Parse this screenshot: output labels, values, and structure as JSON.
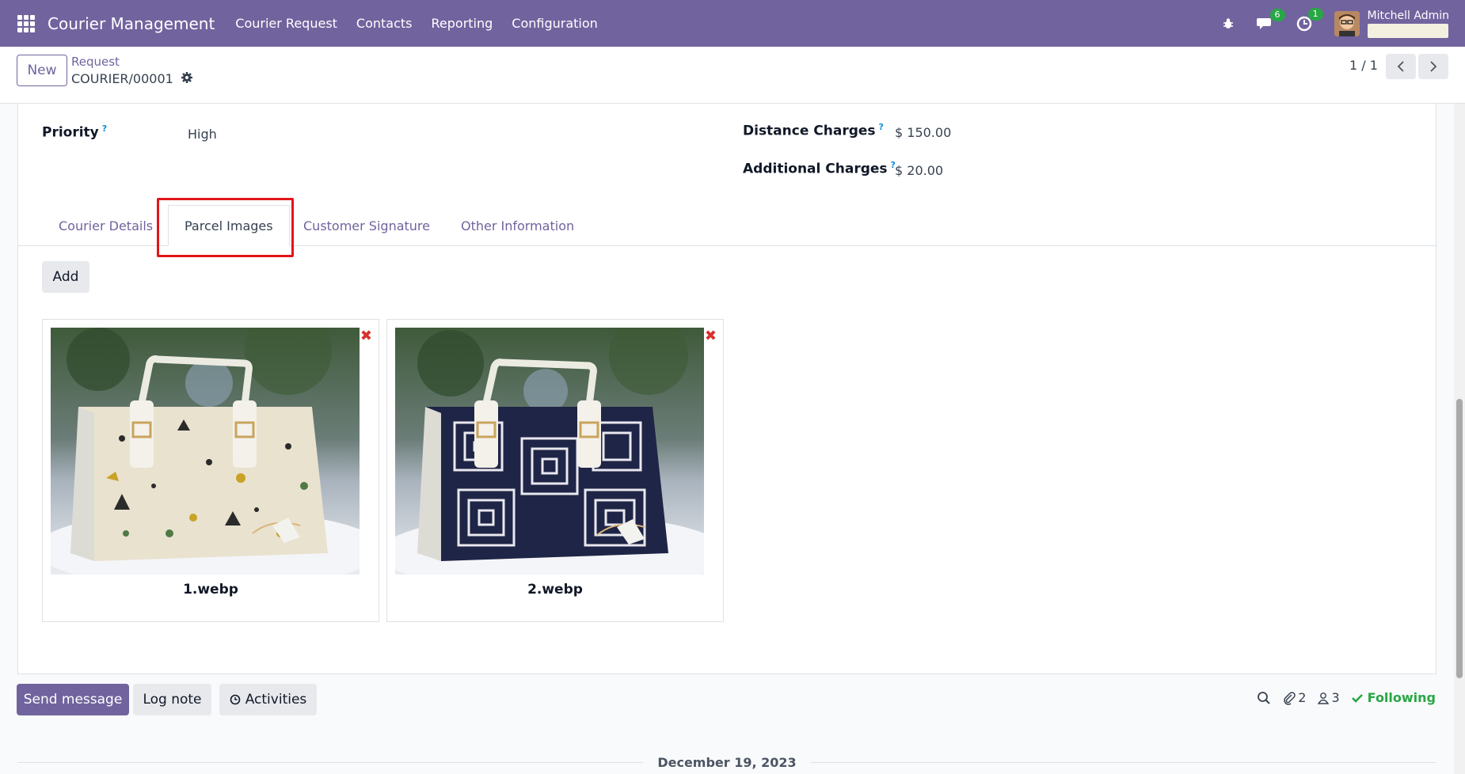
{
  "navbar": {
    "brand": "Courier Management",
    "menu": [
      "Courier Request",
      "Contacts",
      "Reporting",
      "Configuration"
    ],
    "messages_count": "6",
    "activities_count": "1",
    "user_name": "Mitchell Admin"
  },
  "control": {
    "new_label": "New",
    "breadcrumb": "Request",
    "record": "COURIER/00001",
    "pager": "1 / 1"
  },
  "form": {
    "priority_label": "Priority",
    "priority_value": "High",
    "distance_label": "Distance Charges",
    "distance_value": "$ 150.00",
    "additional_label": "Additional Charges",
    "additional_value": "$ 20.00",
    "help_mark": "?"
  },
  "tabs": [
    "Courier Details",
    "Parcel Images",
    "Customer Signature",
    "Other Information"
  ],
  "active_tab": "Parcel Images",
  "parcel": {
    "add_label": "Add",
    "images": [
      {
        "name": "1.webp",
        "pattern": "warli-print-handbag"
      },
      {
        "name": "2.webp",
        "pattern": "navy-maze-handbag"
      }
    ]
  },
  "chatter": {
    "send_label": "Send message",
    "log_label": "Log note",
    "activities_label": "Activities",
    "attachments_count": "2",
    "followers_count": "3",
    "following_label": "Following",
    "date_separator": "December 19, 2023"
  },
  "colors": {
    "brand": "#71639e",
    "highlight": "#e3141b",
    "following": "#28a745"
  }
}
